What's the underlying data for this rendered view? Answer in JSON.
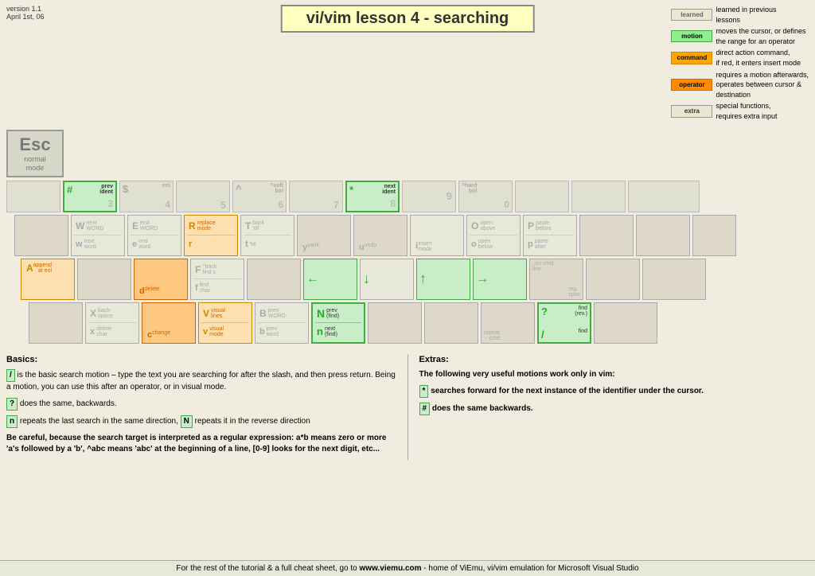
{
  "header": {
    "version": "version 1.1",
    "date": "April 1st, 06",
    "title": "vi/vim lesson 4 - searching"
  },
  "legend": {
    "items": [
      {
        "badge": "learned",
        "color": "normal",
        "desc": "learned in previous lessons"
      },
      {
        "badge": "motion",
        "color": "motion",
        "desc": "moves the cursor, or defines the range for an operator"
      },
      {
        "badge": "command",
        "color": "command",
        "desc": "direct action command, if red, it enters insert mode"
      },
      {
        "badge": "operator",
        "color": "operator",
        "desc": "requires a motion afterwards, operates between cursor & destination"
      },
      {
        "badge": "extra",
        "color": "extra",
        "desc": "special functions, requires extra input"
      }
    ]
  },
  "esc": {
    "label": "Esc",
    "sub1": "normal",
    "sub2": "mode"
  },
  "footer": {
    "text": "For the rest of the tutorial & a full cheat sheet, go to www.viemu.com - home of ViEmu, vi/vim emulation for Microsoft Visual Studio"
  },
  "basics": {
    "title": "Basics:",
    "p1": "/ is the basic search motion – type the text you are searching for after the slash, and then press return. Being a motion, you can use this after an operator, or in visual mode.",
    "p2": "? does the same, backwards.",
    "p3": "n repeats the last search in the same direction, N repeats it in the reverse direction",
    "p4": "Be careful, because the search target is interpreted as a regular expression: a*b means zero or more 'a's followed by a 'b', ^abc means 'abc' at the beginning of a line, [0-9] looks for the next digit, etc..."
  },
  "extras": {
    "title": "Extras:",
    "p1": "The following very useful motions work only in vim:",
    "p2": "* searches forward for the next instance of the identifier under the cursor.",
    "p3": "# does the same backwards."
  }
}
